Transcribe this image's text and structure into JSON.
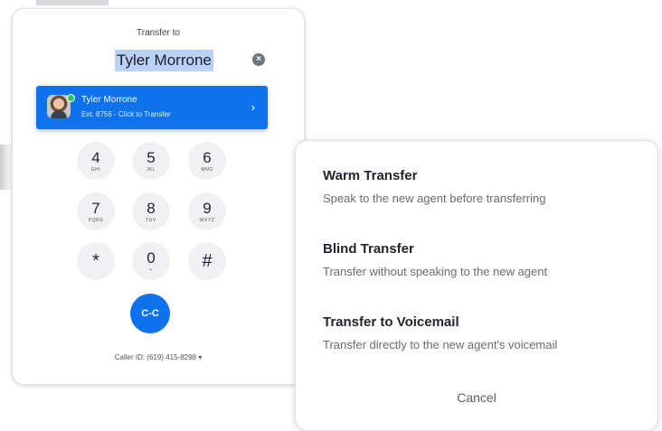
{
  "dialer": {
    "title": "Transfer to",
    "search_value": "Tyler Morrone",
    "clear_icon": "×",
    "result": {
      "name": "Tyler Morrone",
      "subtitle": "Ext. 8756 - Click to Transfer",
      "chevron": "›"
    },
    "keys": [
      {
        "digit": "4",
        "letters": "GHI"
      },
      {
        "digit": "5",
        "letters": "JKL"
      },
      {
        "digit": "6",
        "letters": "MNO"
      },
      {
        "digit": "7",
        "letters": "PQRS"
      },
      {
        "digit": "8",
        "letters": "TUV"
      },
      {
        "digit": "9",
        "letters": "WXYZ"
      },
      {
        "digit": "*",
        "letters": ""
      },
      {
        "digit": "0",
        "letters": "+"
      },
      {
        "digit": "#",
        "letters": ""
      }
    ],
    "call_icon": "C-C",
    "caller_id": "Caller ID: (619) 415-8298 ▾"
  },
  "transfer_options": {
    "items": [
      {
        "title": "Warm Transfer",
        "description": "Speak to the new agent before transferring"
      },
      {
        "title": "Blind Transfer",
        "description": "Transfer without speaking to the new agent"
      },
      {
        "title": "Transfer to Voicemail",
        "description": "Transfer directly to the new agent's voicemail"
      }
    ],
    "cancel_label": "Cancel"
  },
  "colors": {
    "accent": "#0e72ed",
    "selection": "#b9d1f4",
    "presence": "#2fc85a"
  }
}
